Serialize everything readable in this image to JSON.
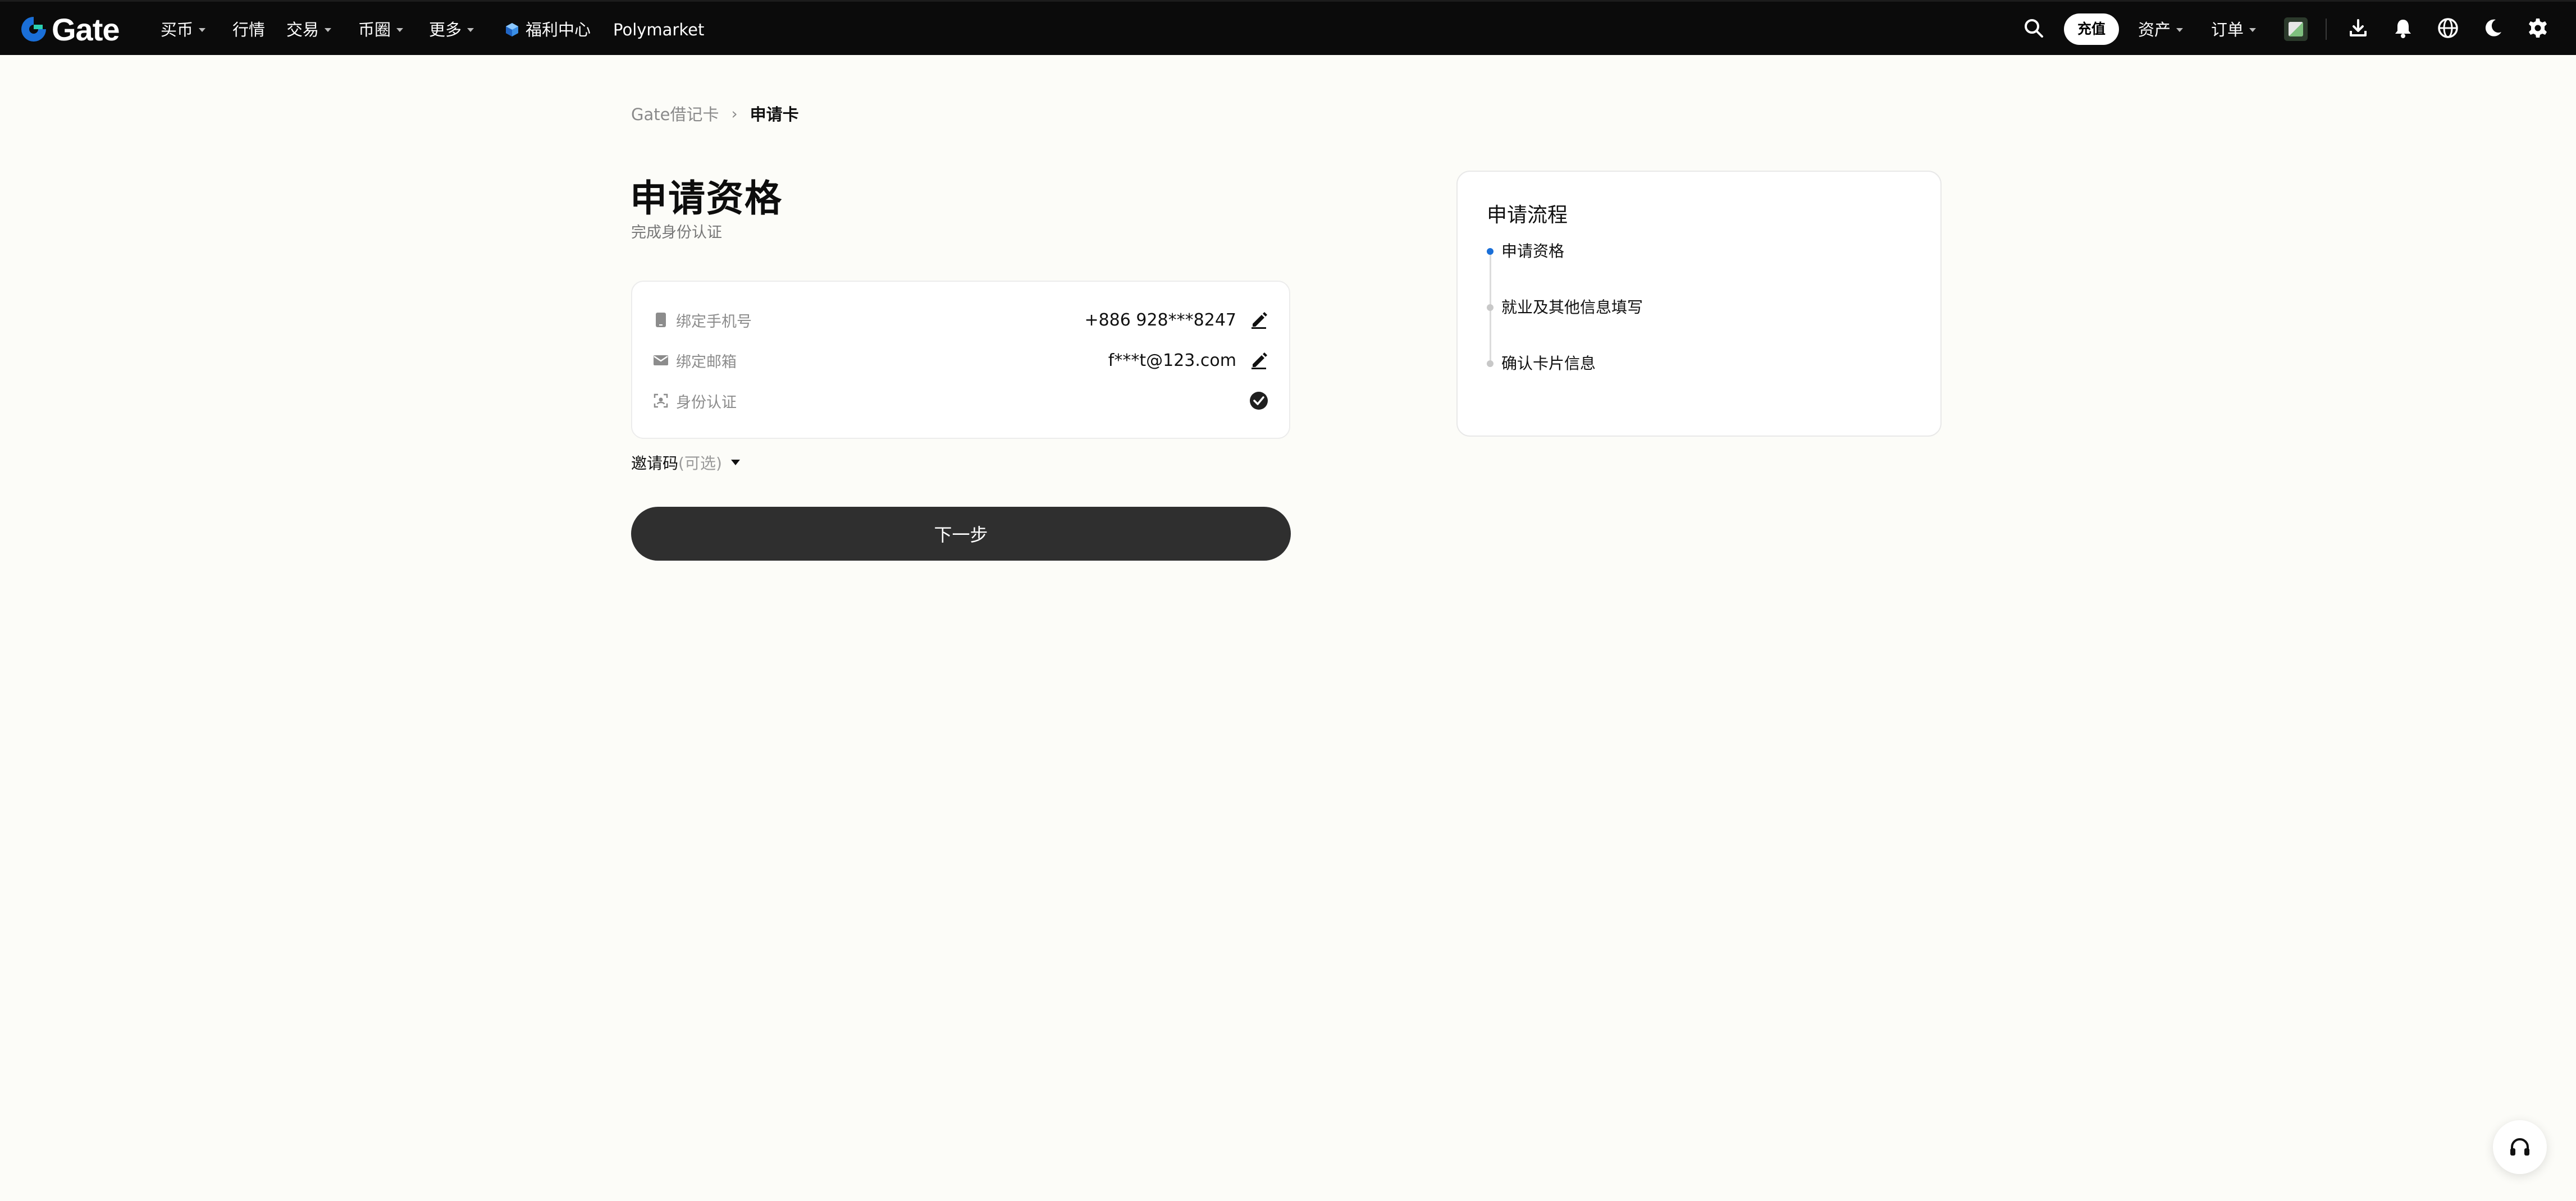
{
  "nav": {
    "logo_text": "Gate",
    "items": [
      {
        "label": "买币",
        "dropdown": true
      },
      {
        "label": "行情",
        "dropdown": false
      },
      {
        "label": "交易",
        "dropdown": true
      },
      {
        "label": "币圈",
        "dropdown": true
      },
      {
        "label": "更多",
        "dropdown": true
      },
      {
        "label": "福利中心",
        "dropdown": false
      },
      {
        "label": "Polymarket",
        "dropdown": false
      }
    ],
    "deposit_label": "充值",
    "assets_label": "资产",
    "orders_label": "订单",
    "right_icons": [
      "search-icon",
      "avatar",
      "download-icon",
      "bell-icon",
      "globe-icon",
      "moon-icon",
      "gear-icon"
    ]
  },
  "breadcrumb": {
    "root": "Gate借记卡",
    "separator": "›",
    "current": "申请卡"
  },
  "main": {
    "title": "申请资格",
    "subtitle": "完成身份认证",
    "rows": [
      {
        "icon": "phone-icon",
        "label": "绑定手机号",
        "value": "+886 928***8247",
        "action": "edit-icon"
      },
      {
        "icon": "mail-icon",
        "label": "绑定邮箱",
        "value": "f***t@123.com",
        "action": "edit-icon"
      },
      {
        "icon": "id-scan-icon",
        "label": "身份认证",
        "value": "",
        "action": "check-icon"
      }
    ],
    "invite_label": "邀请码",
    "invite_optional": "(可选)",
    "next_label": "下一步"
  },
  "process": {
    "title": "申请流程",
    "steps": [
      {
        "label": "申请资格",
        "active": true
      },
      {
        "label": "就业及其他信息填写",
        "active": false
      },
      {
        "label": "确认卡片信息",
        "active": false
      }
    ]
  },
  "colors": {
    "nav_bg": "#0b0b0b",
    "page_bg": "#fcfcf8",
    "primary_button": "#2f2f2f",
    "step_active": "#1a6fd8",
    "logo_blue": "#1a6fd8"
  }
}
